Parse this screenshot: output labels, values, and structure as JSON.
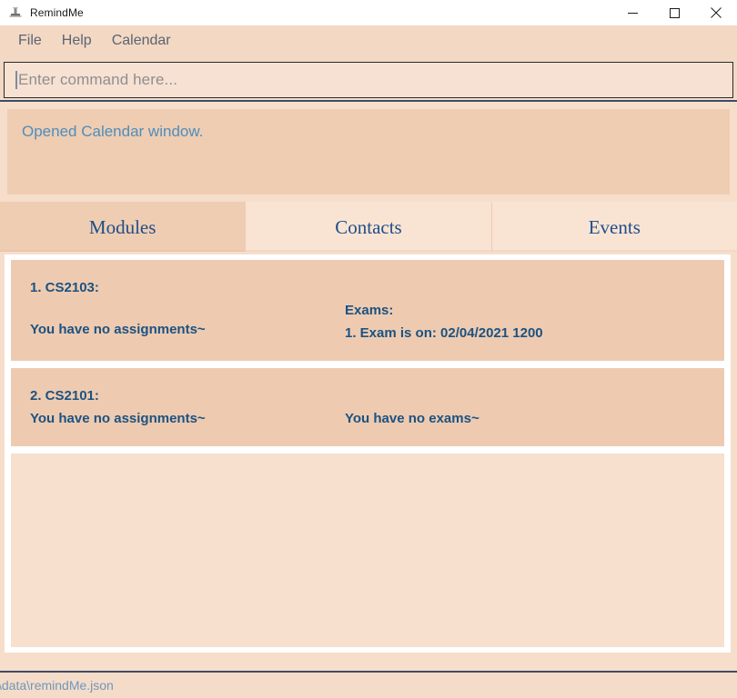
{
  "window": {
    "title": "RemindMe",
    "icon": "app-icon",
    "controls": {
      "minimize": "minimize-icon",
      "maximize": "maximize-icon",
      "close": "close-icon"
    }
  },
  "menu": {
    "items": [
      {
        "label": "File"
      },
      {
        "label": "Help"
      },
      {
        "label": "Calendar"
      }
    ]
  },
  "command": {
    "placeholder": "Enter command here...",
    "value": ""
  },
  "result": {
    "message": "Opened Calendar window."
  },
  "tabs": [
    {
      "label": "Modules",
      "selected": true
    },
    {
      "label": "Contacts",
      "selected": false
    },
    {
      "label": "Events",
      "selected": false
    }
  ],
  "modules": [
    {
      "title": "1. CS2103:",
      "assignments_text": "You have no assignments~",
      "exams_header": "Exams:",
      "exams_entry": "1. Exam is on: 02/04/2021 1200",
      "exams_empty": ""
    },
    {
      "title": "2. CS2101:",
      "assignments_text": "You have no assignments~",
      "exams_header": "",
      "exams_entry": "",
      "exams_empty": "You have no exams~"
    }
  ],
  "status": {
    "file_path": "\\data\\remindMe.json"
  },
  "colors": {
    "window_chrome": "#f3d8c3",
    "page_background": "#f6decb",
    "card_background": "#eecbb0",
    "tab_selected": "#efcdb2",
    "tab_unselected": "#f9e4d4",
    "accent_text": "#1c5282",
    "result_text": "#4f8dbc",
    "menu_text": "#5a6576",
    "divider": "#3c4c68"
  }
}
